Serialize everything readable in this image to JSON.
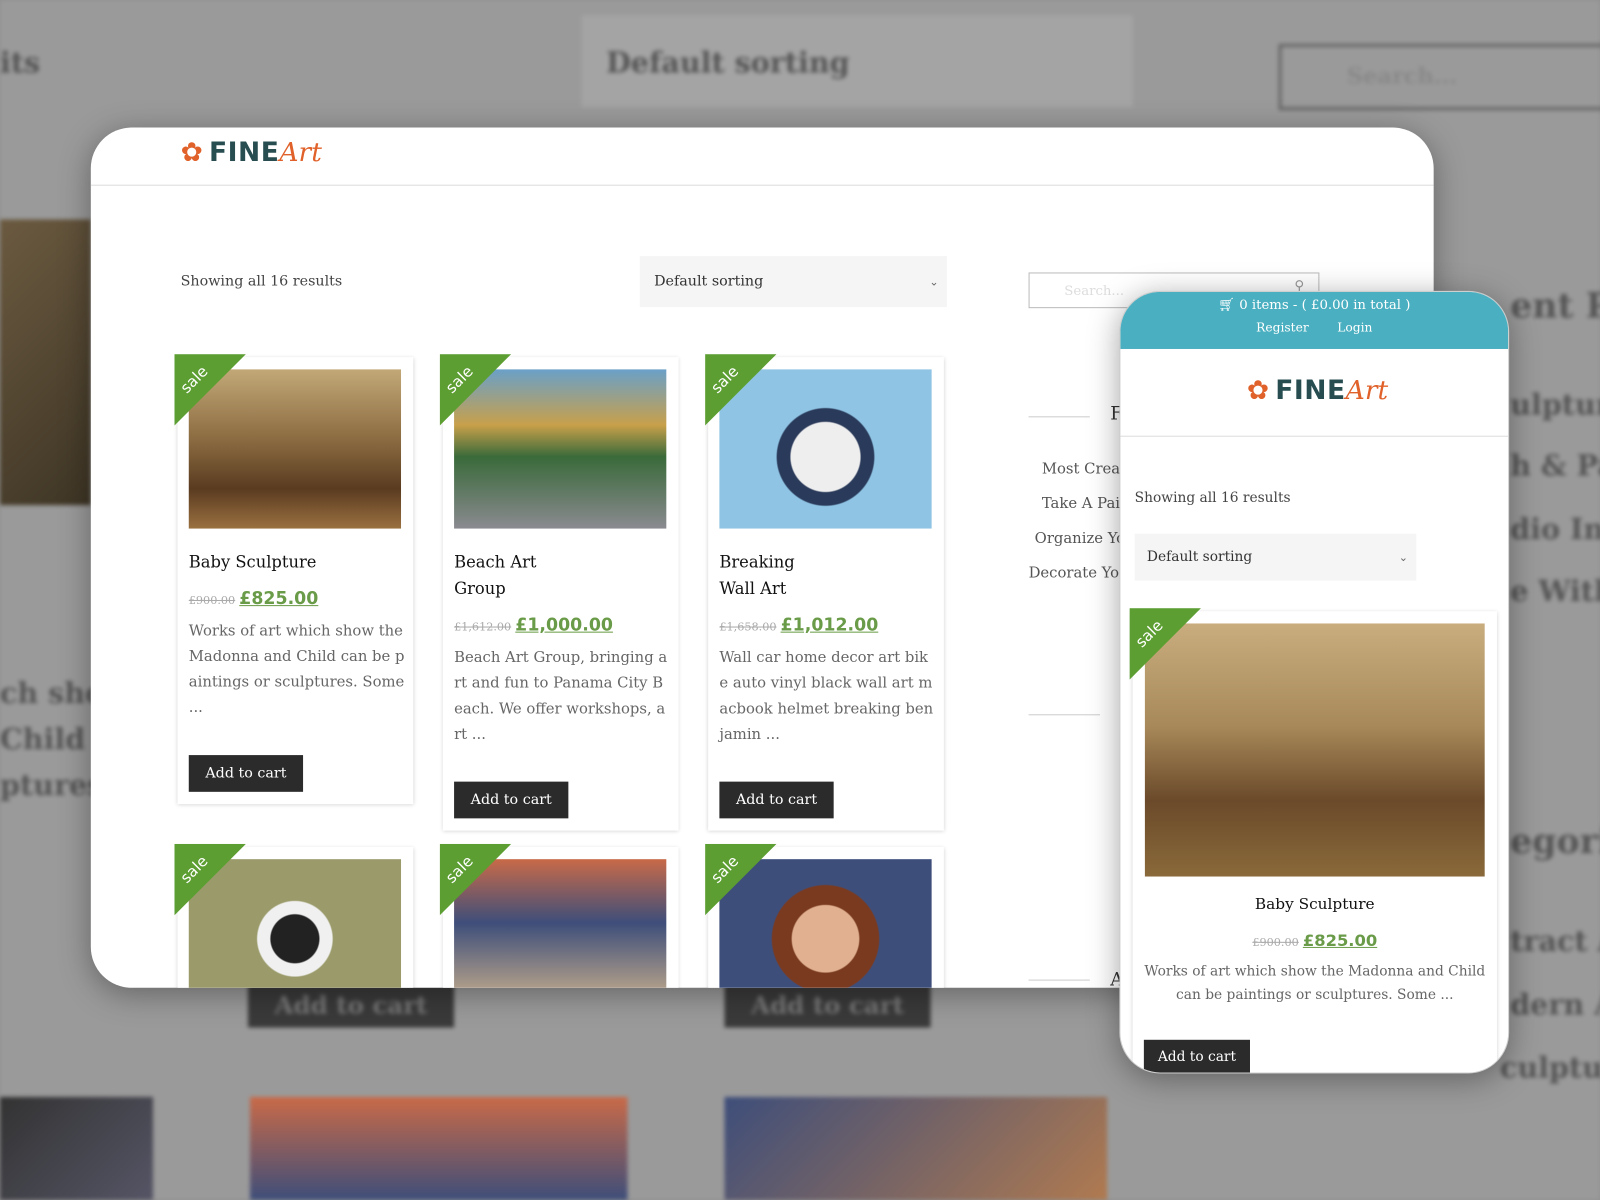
{
  "background": {
    "texts": [
      "its",
      "Default sorting",
      "Search...",
      "ent Po",
      "ulpture",
      "h & Pai",
      "dio In",
      "e With",
      "egori",
      "tract A",
      "dern A",
      "culpture",
      "ch sho",
      "Child ca",
      "ptures."
    ],
    "add_to_cart": "Add to cart",
    "sale": "sale"
  },
  "brand": {
    "name_bold": "FINE",
    "name_script": "Art",
    "accent": "#e0612a",
    "primary": "#274d51"
  },
  "desktop": {
    "result_count": "Showing all 16 results",
    "sorting": "Default sorting",
    "search_placeholder": "Search...",
    "sidebar_heading": "F",
    "sidebar_heading2": "A",
    "sidebar_items": [
      "Most Creat",
      "Take A Pair",
      "Organize Yo",
      "Decorate You"
    ],
    "products": [
      {
        "title": "Baby Sculpture",
        "old_price": "£900.00",
        "price": "£825.00",
        "desc": "Works of art which show the Madonna and Child can be paintings or sculptures. Some ...",
        "button": "Add to cart",
        "badge": "sale"
      },
      {
        "title": "Beach Art Group",
        "old_price": "£1,612.00",
        "price": "£1,000.00",
        "desc": "Beach Art Group, bringing art and fun to Panama City Beach. We offer workshops, art ...",
        "button": "Add to cart",
        "badge": "sale"
      },
      {
        "title": "Breaking Wall Art",
        "old_price": "£1,658.00",
        "price": "£1,012.00",
        "desc": "Wall car home decor art bike auto vinyl black wall art macbook helmet breaking benjamin ...",
        "button": "Add to cart",
        "badge": "sale"
      },
      {
        "badge": "sale"
      },
      {
        "badge": "sale"
      },
      {
        "badge": "sale"
      }
    ]
  },
  "mobile": {
    "cart": "0 items - ( £0.00 in total )",
    "register": "Register",
    "login": "Login",
    "header_color": "#4aafc0",
    "result_count": "Showing all 16 results",
    "sorting": "Default sorting",
    "product": {
      "title": "Baby Sculpture",
      "old_price": "£900.00",
      "price": "£825.00",
      "desc": "Works of art which show the Madonna and Child can be paintings or sculptures. Some ...",
      "button": "Add to cart",
      "badge": "sale"
    }
  }
}
